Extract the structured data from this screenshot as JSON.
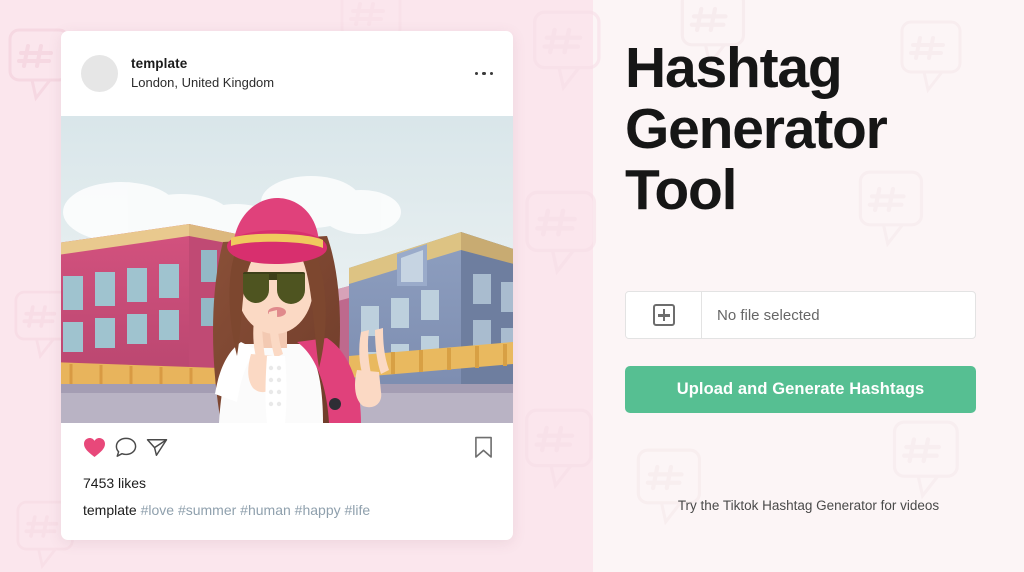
{
  "background": {
    "left_color": "#fbe6ed",
    "right_color": "#fcf5f6",
    "pattern_icon": "hashtag-speech-bubble-icon"
  },
  "post_card": {
    "header": {
      "avatar": "avatar-placeholder-icon",
      "username": "template",
      "location": "London, United Kingdom",
      "more_menu": "more-options-icon"
    },
    "photo": {
      "alt": "illustration-woman-pink-hat-sunglasses-city-street"
    },
    "actions": {
      "like": "heart-icon",
      "comment": "comment-icon",
      "share": "share-icon",
      "save": "bookmark-icon",
      "like_color": "#e8487a"
    },
    "likes": "7453 likes",
    "caption_author": "template",
    "caption_tags": "#love #summer #human #happy #life",
    "tag_color": "#8fa0ad"
  },
  "panel": {
    "title": "Hashtag Generator Tool",
    "file_input": {
      "browse_icon": "plus-box-icon",
      "value": "No file selected"
    },
    "upload_button": {
      "label": "Upload and Generate Hashtags",
      "color": "#56bf92"
    },
    "footnote": "Try the Tiktok Hashtag Generator for videos"
  }
}
